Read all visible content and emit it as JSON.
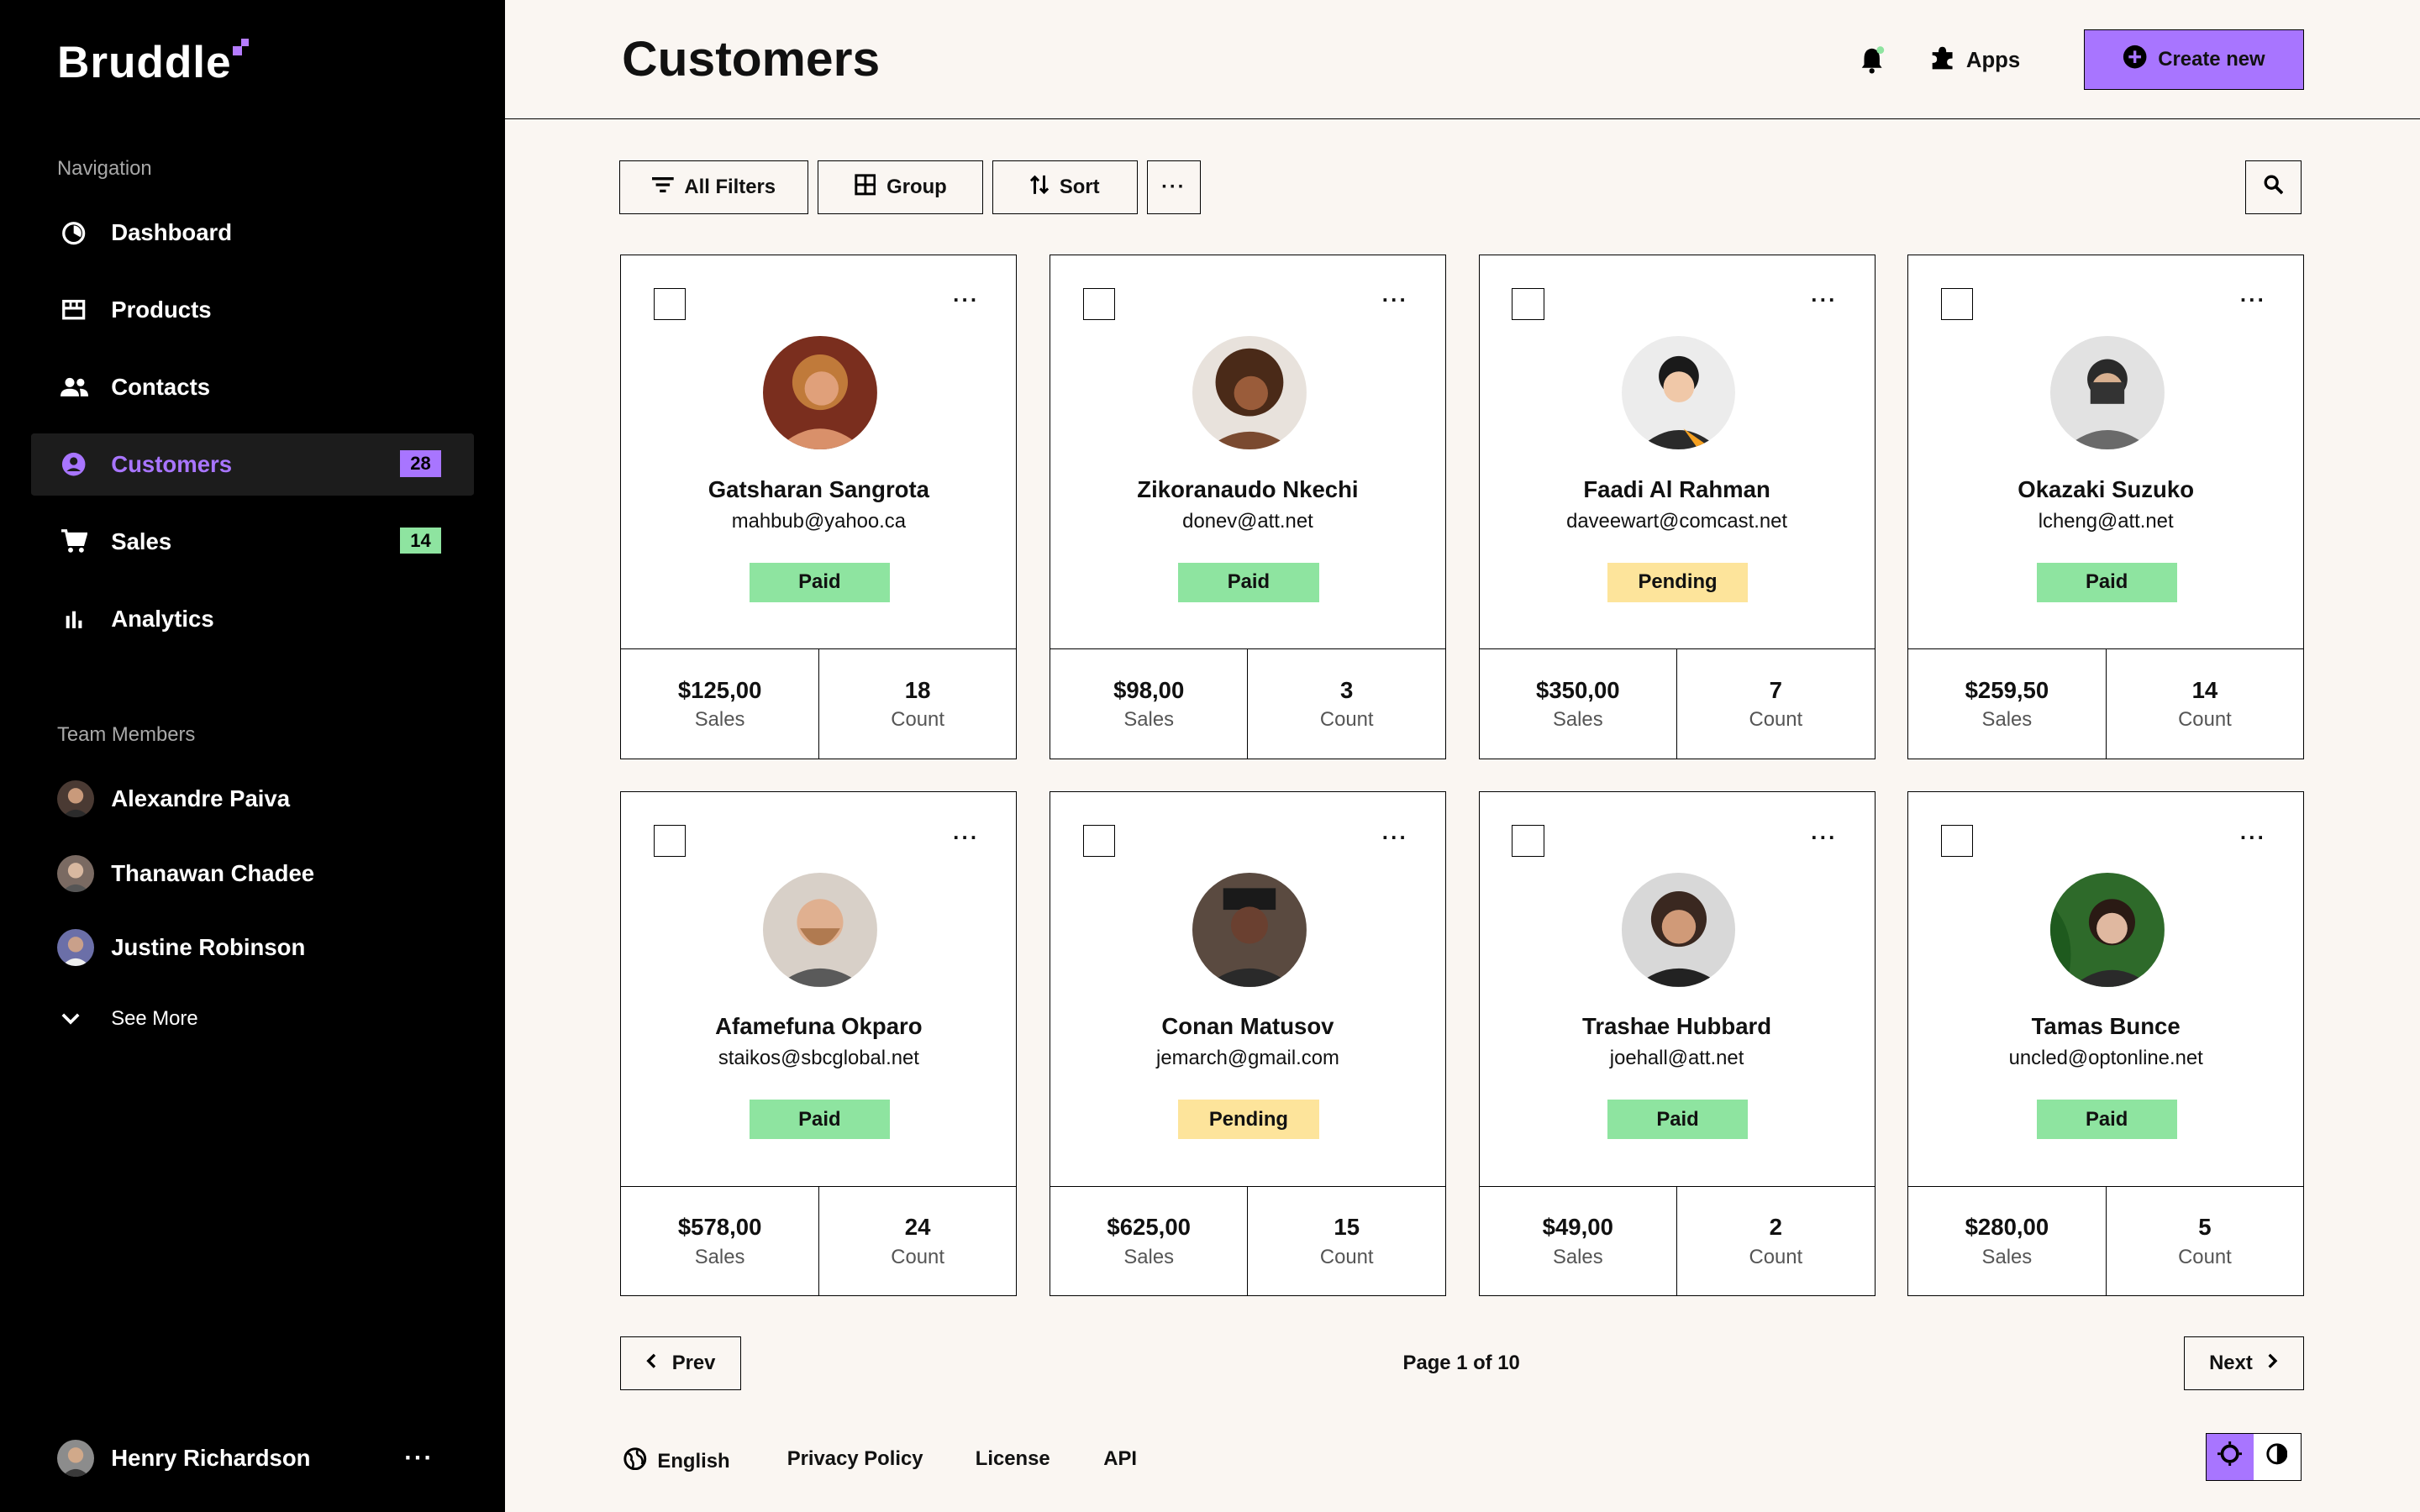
{
  "app": {
    "name": "Bruddle"
  },
  "sidebar": {
    "nav_heading": "Navigation",
    "nav": [
      {
        "label": "Dashboard",
        "icon": "dashboard-icon"
      },
      {
        "label": "Products",
        "icon": "products-icon"
      },
      {
        "label": "Contacts",
        "icon": "contacts-icon"
      },
      {
        "label": "Customers",
        "icon": "customers-icon",
        "badge": "28",
        "active": true
      },
      {
        "label": "Sales",
        "icon": "cart-icon",
        "badge": "14"
      },
      {
        "label": "Analytics",
        "icon": "analytics-icon"
      }
    ],
    "team_heading": "Team Members",
    "team": [
      {
        "name": "Alexandre Paiva"
      },
      {
        "name": "Thanawan Chadee"
      },
      {
        "name": "Justine Robinson"
      }
    ],
    "see_more": "See More",
    "user": {
      "name": "Henry Richardson",
      "more": "···"
    }
  },
  "header": {
    "title": "Customers",
    "apps_label": "Apps",
    "create_label": "Create new"
  },
  "toolbar": {
    "filters_label": "All Filters",
    "group_label": "Group",
    "sort_label": "Sort",
    "more_label": "···"
  },
  "customers": [
    {
      "name": "Gatsharan Sangrota",
      "email": "mahbub@yahoo.ca",
      "status": "Paid",
      "sales": "$125,00",
      "sales_label": "Sales",
      "count": "18",
      "count_label": "Count"
    },
    {
      "name": "Zikoranaudo Nkechi",
      "email": "donev@att.net",
      "status": "Paid",
      "sales": "$98,00",
      "sales_label": "Sales",
      "count": "3",
      "count_label": "Count"
    },
    {
      "name": "Faadi Al Rahman",
      "email": "daveewart@comcast.net",
      "status": "Pending",
      "sales": "$350,00",
      "sales_label": "Sales",
      "count": "7",
      "count_label": "Count"
    },
    {
      "name": "Okazaki Suzuko",
      "email": "lcheng@att.net",
      "status": "Paid",
      "sales": "$259,50",
      "sales_label": "Sales",
      "count": "14",
      "count_label": "Count"
    },
    {
      "name": "Afamefuna Okparo",
      "email": "staikos@sbcglobal.net",
      "status": "Paid",
      "sales": "$578,00",
      "sales_label": "Sales",
      "count": "24",
      "count_label": "Count"
    },
    {
      "name": "Conan Matusov",
      "email": "jemarch@gmail.com",
      "status": "Pending",
      "sales": "$625,00",
      "sales_label": "Sales",
      "count": "15",
      "count_label": "Count"
    },
    {
      "name": "Trashae Hubbard",
      "email": "joehall@att.net",
      "status": "Paid",
      "sales": "$49,00",
      "sales_label": "Sales",
      "count": "2",
      "count_label": "Count"
    },
    {
      "name": "Tamas Bunce",
      "email": "uncled@optonline.net",
      "status": "Paid",
      "sales": "$280,00",
      "sales_label": "Sales",
      "count": "5",
      "count_label": "Count"
    }
  ],
  "pagination": {
    "prev_label": "Prev",
    "next_label": "Next",
    "info": "Page 1 of 10"
  },
  "footer": {
    "language": "English",
    "privacy": "Privacy Policy",
    "license": "License",
    "api": "API"
  },
  "colors": {
    "accent": "#a875ff",
    "paid": "#8ee4a0",
    "pending": "#fde49b",
    "sidebar_bg": "#000000",
    "page_bg": "#faf6f2"
  }
}
